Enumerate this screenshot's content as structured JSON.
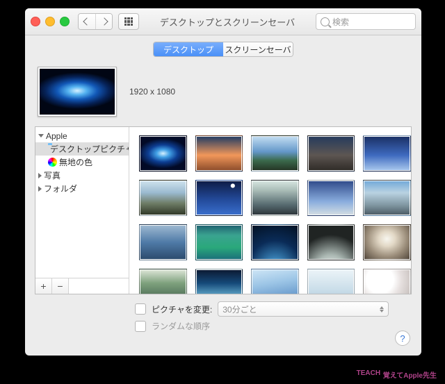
{
  "window": {
    "title": "デスクトップとスクリーンセーバ",
    "search_placeholder": "検索"
  },
  "tabs": {
    "desktop": "デスクトップ",
    "screensaver": "スクリーンセーバ",
    "active": "desktop"
  },
  "preview": {
    "resolution": "1920 x 1080"
  },
  "sidebar": {
    "items": [
      {
        "label": "Apple",
        "expanded": true,
        "children": [
          {
            "label": "デスクトップピクチャ",
            "icon": "folder",
            "selected": true
          },
          {
            "label": "無地の色",
            "icon": "colorwheel"
          }
        ]
      },
      {
        "label": "写真",
        "expanded": false
      },
      {
        "label": "フォルダ",
        "expanded": false
      }
    ],
    "add": "+",
    "remove": "−"
  },
  "options": {
    "change_label": "ピクチャを変更:",
    "interval": "30分ごと",
    "random_label": "ランダムな順序"
  },
  "help": "?",
  "watermark": "覚えてApple先生"
}
